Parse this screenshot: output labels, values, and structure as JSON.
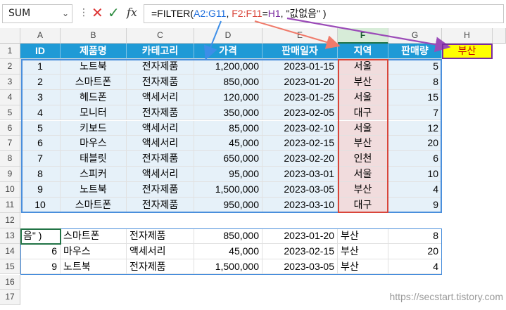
{
  "formula_bar": {
    "name_box": "SUM",
    "formula_prefix": "=FILTER(",
    "range_ref": "A2:G11",
    "sep1": ", ",
    "cond_ref": "F2:F11",
    "eq": "=",
    "crit_ref": "H1",
    "sep2": ", ",
    "empty_text": "\"값없음\"",
    "closing": " )"
  },
  "columns": [
    "A",
    "B",
    "C",
    "D",
    "E",
    "F",
    "G",
    "H"
  ],
  "rows": [
    "1",
    "2",
    "3",
    "4",
    "5",
    "6",
    "7",
    "8",
    "9",
    "10",
    "11",
    "12",
    "13",
    "14",
    "15",
    "16",
    "17"
  ],
  "header": [
    "ID",
    "제품명",
    "카테고리",
    "가격",
    "판매일자",
    "지역",
    "판매량"
  ],
  "criteria": "부산",
  "data": [
    [
      "1",
      "노트북",
      "전자제품",
      "1,200,000",
      "2023-01-15",
      "서울",
      "5"
    ],
    [
      "2",
      "스마트폰",
      "전자제품",
      "850,000",
      "2023-01-20",
      "부산",
      "8"
    ],
    [
      "3",
      "헤드폰",
      "액세서리",
      "120,000",
      "2023-01-25",
      "서울",
      "15"
    ],
    [
      "4",
      "모니터",
      "전자제품",
      "350,000",
      "2023-02-05",
      "대구",
      "7"
    ],
    [
      "5",
      "키보드",
      "액세서리",
      "85,000",
      "2023-02-10",
      "서울",
      "12"
    ],
    [
      "6",
      "마우스",
      "액세서리",
      "45,000",
      "2023-02-15",
      "부산",
      "20"
    ],
    [
      "7",
      "태블릿",
      "전자제품",
      "650,000",
      "2023-02-20",
      "인천",
      "6"
    ],
    [
      "8",
      "스피커",
      "액세서리",
      "95,000",
      "2023-03-01",
      "서울",
      "10"
    ],
    [
      "9",
      "노트북",
      "전자제품",
      "1,500,000",
      "2023-03-05",
      "부산",
      "4"
    ],
    [
      "10",
      "스마트폰",
      "전자제품",
      "950,000",
      "2023-03-10",
      "대구",
      "9"
    ]
  ],
  "results": [
    [
      "음\" )",
      "스마트폰",
      "전자제품",
      "850,000",
      "2023-01-20",
      "부산",
      "8"
    ],
    [
      "6",
      "마우스",
      "액세서리",
      "45,000",
      "2023-02-15",
      "부산",
      "20"
    ],
    [
      "9",
      "노트북",
      "전자제품",
      "1,500,000",
      "2023-03-05",
      "부산",
      "4"
    ]
  ],
  "watermark": "https://secstart.tistory.com",
  "colors": {
    "header_bg": "#1f9ad6",
    "band": "#e6f1f9",
    "highlight": "#f1dcdd",
    "criteria_bg": "#ffff00",
    "criteria_text": "#c00000"
  }
}
